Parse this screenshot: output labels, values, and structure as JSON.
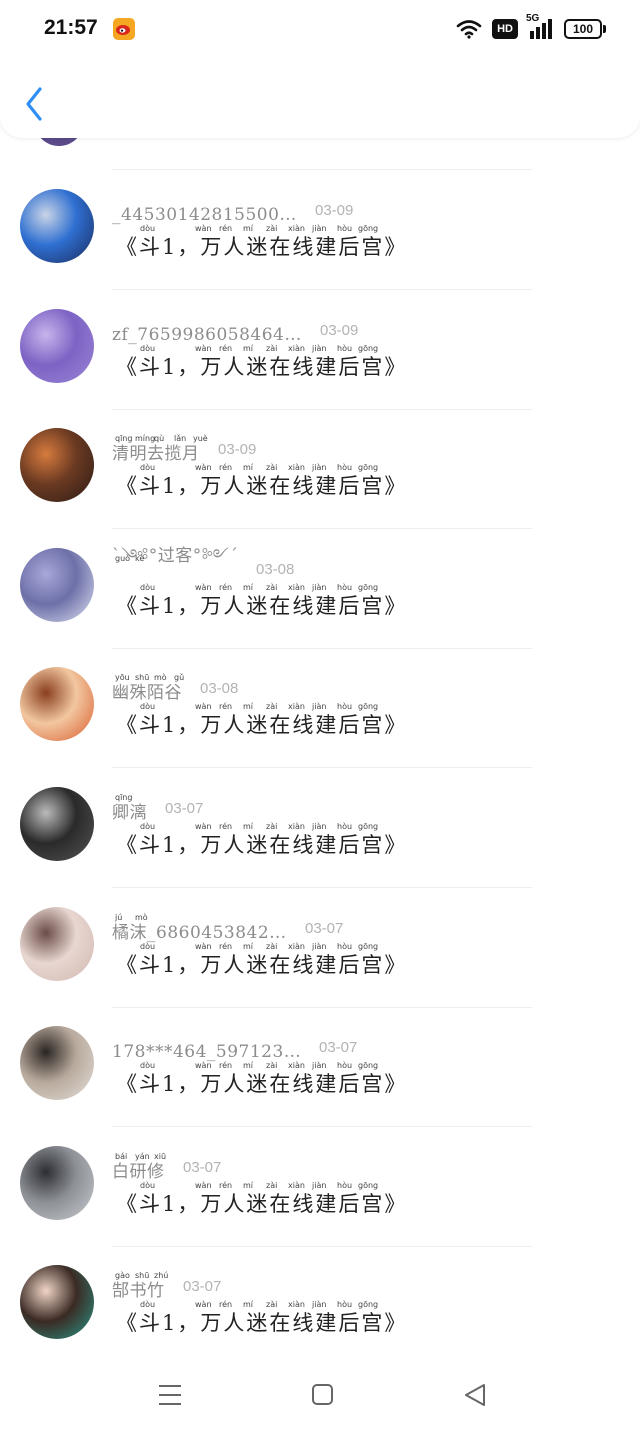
{
  "status_bar": {
    "time": "21:57",
    "hd": "HD",
    "network": "5G",
    "battery": "100"
  },
  "header": {
    "back_icon": "chevron-left-icon",
    "accent": "#2f8ef4"
  },
  "messages": [
    {
      "name": "_44530142815500…",
      "date": "03-09",
      "text": "《斗1，万人迷在线建后宫》",
      "avatar_colors": [
        "#1a2a5c",
        "#c9d4e6",
        "#2f6fd1"
      ]
    },
    {
      "name": "zf_7659986058464…",
      "date": "03-09",
      "text": "《斗1，万人迷在线建后宫》",
      "avatar_colors": [
        "#9a86d6",
        "#c6b5ec",
        "#7d63c4"
      ]
    },
    {
      "name": "清明去揽月",
      "date": "03-09",
      "text": "《斗1，万人迷在线建后宫》",
      "avatar_colors": [
        "#2b1a14",
        "#d77b3e",
        "#6b3a22"
      ]
    },
    {
      "name": "ˋ༺°过客°༻ˊ",
      "date": "03-08",
      "text": "《斗1，万人迷在线建后宫》",
      "avatar_colors": [
        "#dfe5f3",
        "#a7a9d9",
        "#6d6fa8"
      ]
    },
    {
      "name": "幽殊陌谷",
      "date": "03-08",
      "text": "《斗1，万人迷在线建后宫》",
      "avatar_colors": [
        "#d95a2b",
        "#8a3f20",
        "#f2c7a0"
      ]
    },
    {
      "name": "卿漓",
      "date": "03-07",
      "text": "《斗1，万人迷在线建后宫》",
      "avatar_colors": [
        "#555",
        "#bbbbbb",
        "#2a2a2a"
      ]
    },
    {
      "name": "橘沫_6860453842…",
      "date": "03-07",
      "text": "《斗1，万人迷在线建后宫》",
      "avatar_colors": [
        "#cfb8b0",
        "#6b4c48",
        "#e8d6d0"
      ]
    },
    {
      "name": "178***464_597123…",
      "date": "03-07",
      "text": "《斗1，万人迷在线建后宫》",
      "avatar_colors": [
        "#e5e1dc",
        "#2a2522",
        "#b8a99c"
      ]
    },
    {
      "name": "白研修",
      "date": "03-07",
      "text": "《斗1，万人迷在线建后宫》",
      "avatar_colors": [
        "#c9ccd1",
        "#2c2e33",
        "#8d9096"
      ]
    },
    {
      "name": "郜书竹",
      "date": "03-07",
      "text": "《斗1，万人迷在线建后宫》",
      "avatar_colors": [
        "#2a9a8a",
        "#f0d5c6",
        "#3b2a24"
      ]
    }
  ],
  "pinyin": {
    "dou": "dòu",
    "wan": "wàn",
    "ren": "rén",
    "mi": "mí",
    "zai": "zài",
    "xian": "xiàn",
    "jian": "jiàn",
    "hou": "hòu",
    "gong": "gōng",
    "names": [
      [],
      [],
      [
        "qīng",
        "míng",
        "qù",
        "lǎn",
        "yuè"
      ],
      [
        "guò",
        "kè"
      ],
      [
        "yōu",
        "shū",
        "mò",
        "gǔ"
      ],
      [
        "qīng"
      ],
      [
        "jú",
        "mò"
      ],
      [],
      [
        "bái",
        "yán",
        "xiū"
      ],
      [
        "gào",
        "shū",
        "zhú"
      ]
    ]
  },
  "nav": {
    "menu_icon": "menu-icon",
    "home_icon": "home-icon",
    "back_icon": "back-triangle-icon"
  }
}
